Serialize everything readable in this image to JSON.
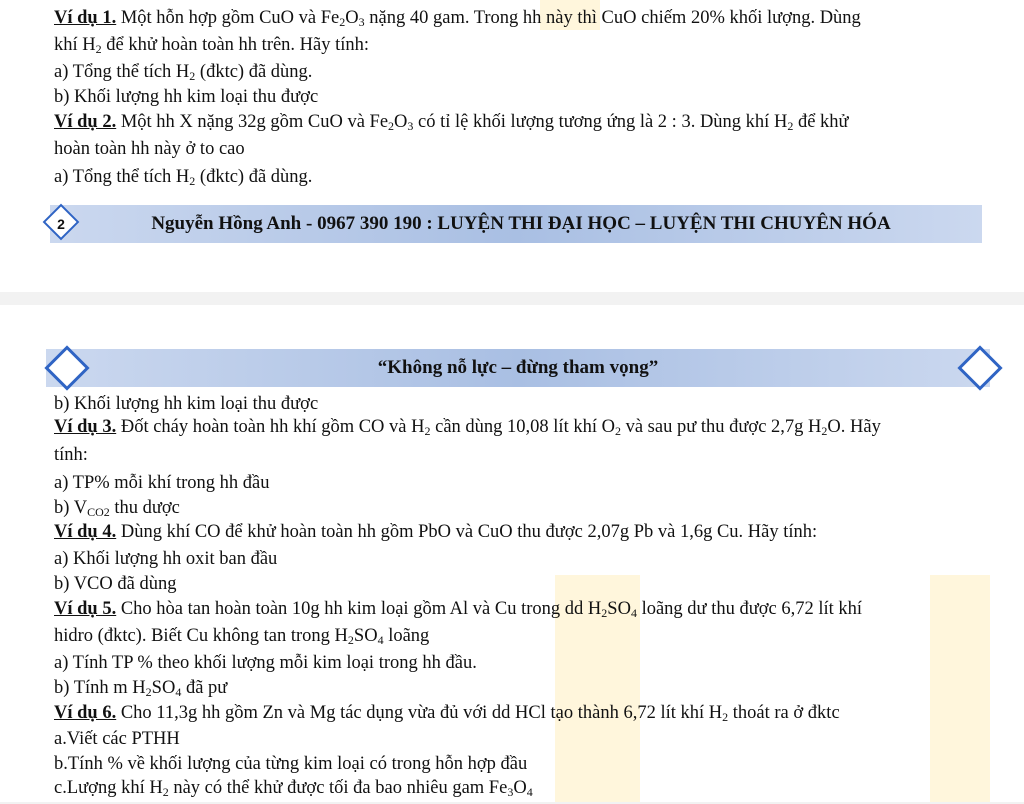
{
  "page1": {
    "ex1_label": "Ví dụ 1.",
    "ex1_text_a": " Một hỗn hợp gồm CuO và Fe",
    "ex1_text_b": "O",
    "ex1_text_c": " nặng 40 gam. Trong hh này thì CuO chiếm 20% khối lượng. Dùng",
    "ex1_line2_a": "khí H",
    "ex1_line2_b": " để khử hoàn toàn hh trên. Hãy tính:",
    "ex1_a_pre": "a) Tổng thể tích H",
    "ex1_a_post": " (đktc) đã dùng.",
    "ex1_b": "b) Khối lượng hh kim loại thu được",
    "ex2_label": "Ví dụ 2.",
    "ex2_text_a": " Một hh X nặng 32g gồm CuO và Fe",
    "ex2_text_b": "O",
    "ex2_text_c": " có tỉ lệ khối lượng tương ứng là 2 : 3. Dùng khí H",
    "ex2_text_d": " để khử",
    "ex2_line2": "hoàn toàn hh này ở to cao",
    "ex2_a_pre": "a) Tổng thể tích H",
    "ex2_a_post": " (đktc) đã dùng.",
    "page_number": "2",
    "footer": "Nguyễn Hồng Anh - 0967 390 190 : LUYỆN THI ĐẠI HỌC – LUYỆN THI CHUYÊN HÓA"
  },
  "page2": {
    "header": "“Không nỗ lực – đừng tham vọng”",
    "ex2_b": "b) Khối lượng hh kim loại thu được",
    "ex3_label": "Ví dụ 3.",
    "ex3_a": " Đốt cháy hoàn toàn hh khí gồm CO và H",
    "ex3_b": " cần dùng 10,08 lít khí O",
    "ex3_c": " và sau pư thu được 2,7g H",
    "ex3_d": "O. Hãy",
    "ex3_line2": "tính:",
    "ex3_qa": "a) TP% mỗi khí trong hh đầu",
    "ex3_qb_pre": "b) V",
    "ex3_qb_sub": "CO2",
    "ex3_qb_post": " thu dược",
    "ex4_label": "Ví dụ 4.",
    "ex4_text": " Dùng khí CO để khử hoàn toàn hh gồm PbO và CuO thu được 2,07g Pb và 1,6g Cu. Hãy tính:",
    "ex4_qa": "a) Khối lượng hh oxit ban đầu",
    "ex4_qb": "b) VCO đã dùng",
    "ex5_label": "Ví dụ 5.",
    "ex5_a": " Cho hòa tan hoàn toàn 10g hh kim loại gồm Al và Cu trong dd H",
    "ex5_b": "SO",
    "ex5_c": " loãng dư thu được 6,72 lít khí",
    "ex5_line2_a": "hidro (đktc). Biết Cu không tan trong H",
    "ex5_line2_b": "SO",
    "ex5_line2_c": " loãng",
    "ex5_qa": "a) Tính TP % theo khối lượng mỗi kim loại trong hh đầu.",
    "ex5_qb_a": "b) Tính m H",
    "ex5_qb_b": "SO",
    "ex5_qb_c": " đã pư",
    "ex6_label": "Ví dụ 6.",
    "ex6_a": " Cho 11,3g hh gồm Zn và Mg tác dụng vừa đủ với dd HCl tạo thành 6,72 lít khí H",
    "ex6_b": " thoát ra ở đktc",
    "ex6_qa": "a.Viết các PTHH",
    "ex6_qb": "b.Tính % về khối lượng của từng kim loại có trong hỗn hợp đầu",
    "ex6_qc_a": "c.Lượng khí H",
    "ex6_qc_b": " này có thể khử được tối đa bao nhiêu gam Fe",
    "ex6_qc_c": "O"
  },
  "sub": {
    "two": "2",
    "three": "3",
    "four": "4"
  },
  "colors": {
    "banner": "#a9bfe3",
    "diamond_border": "#2f64c4",
    "watermark": "#fff6dc"
  }
}
